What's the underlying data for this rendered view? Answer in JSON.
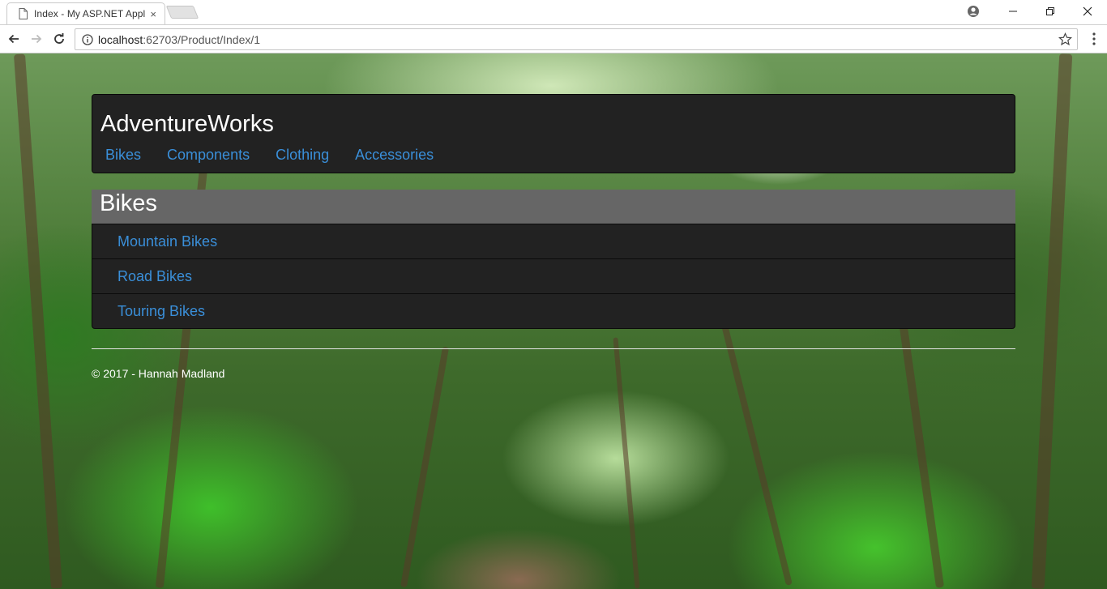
{
  "browser": {
    "tab_title": "Index - My ASP.NET Application",
    "tab_close": "×",
    "url_host": "localhost",
    "url_path": ":62703/Product/Index/1"
  },
  "site": {
    "brand": "AdventureWorks",
    "nav": [
      "Bikes",
      "Components",
      "Clothing",
      "Accessories"
    ],
    "link_color": "#3a8fd9"
  },
  "panel": {
    "title": "Bikes",
    "items": [
      "Mountain Bikes",
      "Road Bikes",
      "Touring Bikes"
    ]
  },
  "footer": {
    "text": "© 2017 - Hannah Madland"
  }
}
